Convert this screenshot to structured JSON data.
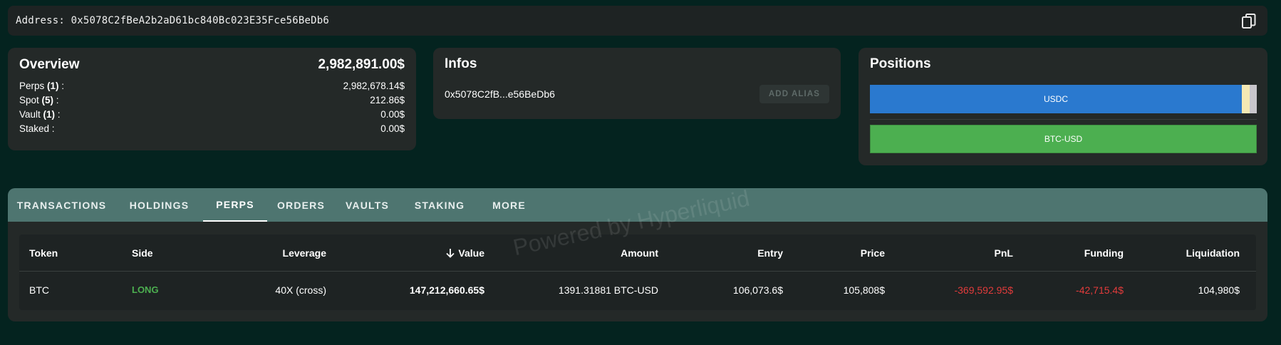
{
  "address_bar": {
    "text": "Address: 0x5078C2fBeA2b2aD61bc840Bc023E35Fce56BeDb6",
    "copy_icon": "copy-icon"
  },
  "overview": {
    "title": "Overview",
    "total": "2,982,891.00$",
    "rows": [
      {
        "label": "Perps ",
        "count": "(1)",
        "suffix": " :",
        "value": "2,982,678.14$"
      },
      {
        "label": "Spot ",
        "count": "(5)",
        "suffix": " :",
        "value": "212.86$"
      },
      {
        "label": "Vault ",
        "count": "(1)",
        "suffix": " :",
        "value": "0.00$"
      },
      {
        "label": "Staked :",
        "count": "",
        "suffix": "",
        "value": "0.00$"
      }
    ]
  },
  "infos": {
    "title": "Infos",
    "short_address": "0x5078C2fB...e56BeDb6",
    "alias_button": "ADD ALIAS"
  },
  "positions": {
    "title": "Positions",
    "bars": [
      {
        "label": "USDC",
        "color": "#2a79cf"
      },
      {
        "label": "BTC-USD",
        "color": "#4caf50"
      }
    ]
  },
  "tabs": [
    {
      "label": "TRANSACTIONS",
      "active": false
    },
    {
      "label": "HOLDINGS",
      "active": false
    },
    {
      "label": "PERPS",
      "active": true
    },
    {
      "label": "ORDERS",
      "active": false
    },
    {
      "label": "VAULTS",
      "active": false
    },
    {
      "label": "STAKING",
      "active": false
    },
    {
      "label": "MORE",
      "active": false
    }
  ],
  "table": {
    "sort_icon": "arrow-down-icon",
    "headers": [
      "Token",
      "Side",
      "Leverage",
      "Value",
      "Amount",
      "Entry",
      "Price",
      "PnL",
      "Funding",
      "Liquidation"
    ],
    "rows": [
      {
        "token": "BTC",
        "side": "LONG",
        "leverage": "40X (cross)",
        "value": "147,212,660.65$",
        "amount": "1391.31881 BTC-USD",
        "entry": "106,073.6$",
        "price": "105,808$",
        "pnl": "-369,592.95$",
        "funding": "-42,715.4$",
        "liquidation": "104,980$"
      }
    ]
  },
  "watermark": "Powered by Hyperliquid",
  "colors": {
    "background": "#04231f",
    "card": "#242928",
    "tab_bar": "#4e7570",
    "long": "#4caf50",
    "negative": "#e23b3b",
    "usdc_bar": "#2a79cf",
    "btc_bar": "#4caf50"
  }
}
